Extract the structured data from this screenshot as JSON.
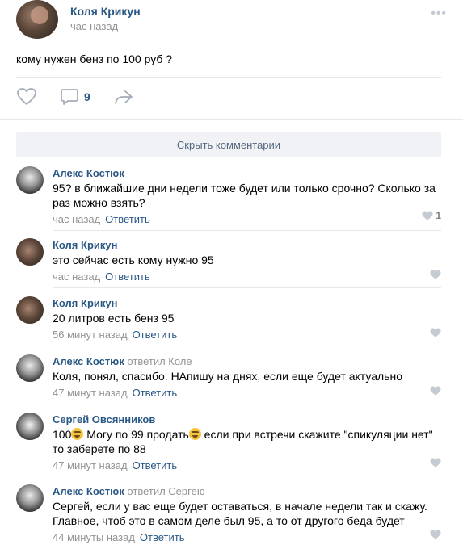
{
  "post": {
    "author": "Коля Крикун",
    "time": "час назад",
    "text": "кому нужен бенз по 100 руб ?",
    "more": "•••",
    "comments_count": "9"
  },
  "hide_comments_label": "Скрыть комментарии",
  "reply_label": "Ответить",
  "comments": [
    {
      "author": "Алекс Костюк",
      "reply_to": "",
      "text": "95? в ближайшие дни недели тоже будет или только срочно? Сколько за раз можно взять?",
      "time": "час назад",
      "likes": "1"
    },
    {
      "author": "Коля Крикун",
      "reply_to": "",
      "text": "это сейчас есть кому нужно 95",
      "time": "час назад",
      "likes": ""
    },
    {
      "author": "Коля Крикун",
      "reply_to": "",
      "text": "20 литров есть бенз 95",
      "time": "56 минут назад",
      "likes": ""
    },
    {
      "author": "Алекс Костюк",
      "reply_to": "ответил Коле",
      "text": "Коля, понял, спасибо. НАпишу на днях, если еще будет актуально",
      "time": "47 минут назад",
      "likes": ""
    },
    {
      "author": "Сергей Овсянников",
      "reply_to": "",
      "text_parts": [
        "100",
        " Могу по 99 продать",
        " если при встречи скажите \"спикуляции нет\" то заберете по 88"
      ],
      "time": "47 минут назад",
      "likes": ""
    },
    {
      "author": "Алекс Костюк",
      "reply_to": "ответил Сергею",
      "text": "Сергей, если у вас еще будет оставаться, в начале недели так и скажу. Главное, чтоб это в самом деле был 95, а то от другого беда будет",
      "time": "44 минуты назад",
      "likes": ""
    }
  ],
  "icons": {
    "like": "heart-icon",
    "comment": "comment-icon",
    "share": "share-icon"
  },
  "colors": {
    "link": "#2a5885",
    "muted": "#939393",
    "button_bg": "#f0f2f5"
  }
}
